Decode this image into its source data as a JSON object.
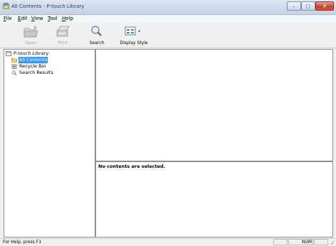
{
  "window": {
    "title": "All Contents - P-touch Library",
    "controls": {
      "minimize": "–",
      "maximize": "▢",
      "close": "✕"
    }
  },
  "menu": [
    {
      "label": "File",
      "key": "F",
      "rest": "ile"
    },
    {
      "label": "Edit",
      "key": "E",
      "rest": "dit"
    },
    {
      "label": "View",
      "key": "V",
      "rest": "iew"
    },
    {
      "label": "Tool",
      "key": "T",
      "rest": "ool"
    },
    {
      "label": "Help",
      "key": "H",
      "rest": "elp"
    }
  ],
  "toolbar": {
    "open": {
      "label": "Open",
      "enabled": false,
      "icon": "open-folder-icon"
    },
    "print": {
      "label": "Print",
      "enabled": false,
      "icon": "printer-icon"
    },
    "search": {
      "label": "Search",
      "enabled": true,
      "icon": "magnifier-icon"
    },
    "display_style": {
      "label": "Display Style",
      "enabled": true,
      "icon": "display-style-icon",
      "dropdown": "▾"
    }
  },
  "tree": {
    "root": {
      "label": "P-touch Library",
      "icon": "library-icon"
    },
    "items": [
      {
        "label": "All Contents",
        "icon": "folder-icon",
        "selected": true
      },
      {
        "label": "Recycle Bin",
        "icon": "recycle-bin-icon",
        "selected": false
      },
      {
        "label": "Search Results",
        "icon": "search-results-icon",
        "selected": false
      }
    ]
  },
  "info_pane": {
    "message": "No contents are selected."
  },
  "statusbar": {
    "help_text": "For Help, press F1",
    "num_indicator": "NUM"
  },
  "colors": {
    "selection": "#3399ff",
    "titlebar": "#cfdceb",
    "close_button": "#c6452f"
  }
}
